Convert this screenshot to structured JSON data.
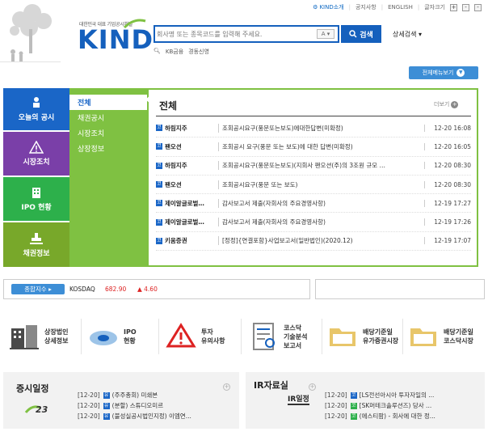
{
  "header": {
    "top_links": [
      "KIND소개",
      "공지사항",
      "ENGLISH",
      "글자크기"
    ],
    "zoom_buttons": [
      "+",
      "-",
      "-"
    ],
    "logo_sub": "대한민국 대표 기업공시채널",
    "logo_text": "KIND",
    "search_placeholder": "회사명 또는 종목코드를 입력해 주세요.",
    "search_select": "A",
    "search_button": "검색",
    "advanced_search": "상세검색",
    "quick_links": [
      "KB금융",
      "경동신영"
    ],
    "full_menu": "전체메뉴보기"
  },
  "nav": [
    {
      "label": "오늘의 공시",
      "icon": "person-icon"
    },
    {
      "label": "시장조치",
      "icon": "warning-icon"
    },
    {
      "label": "IPO 현황",
      "icon": "building-icon"
    },
    {
      "label": "채권정보",
      "icon": "stamp-icon"
    }
  ],
  "submenu": [
    "전체",
    "채권공시",
    "시장조치",
    "상장정보"
  ],
  "panel": {
    "title": "전체",
    "more": "더보기",
    "rows": [
      {
        "badge": "코",
        "company": "하림지주",
        "title": "조회공시요구(풍문또는보도)에대한답변(미확정)",
        "date": "12-20 16:08"
      },
      {
        "badge": "코",
        "company": "팬오션",
        "title": "조회공시 요구(풍문 또는 보도)에 대한 답변(미확정)",
        "date": "12-20 16:05"
      },
      {
        "badge": "코",
        "company": "하림지주",
        "title": "조회공시요구(풍문또는보도)(지회사 팬오션(주)의 3조원 규모 …",
        "date": "12-20 08:30"
      },
      {
        "badge": "코",
        "company": "팬오션",
        "title": "조회공시요구(풍문 또는 보도)",
        "date": "12-20 08:30"
      },
      {
        "badge": "코",
        "company": "제이알글로벌…",
        "title": "감사보고서 제출(자회사의 주요경영사항)",
        "date": "12-19 17:27"
      },
      {
        "badge": "코",
        "company": "제이알글로벌…",
        "title": "감사보고서 제출(자회사의 주요경영사항)",
        "date": "12-19 17:26"
      },
      {
        "badge": "코",
        "company": "키움증권",
        "title": "[정정]{연결포함}사업보고서(일반법인)(2020.12)",
        "date": "12-19 17:07"
      }
    ]
  },
  "index": {
    "label": "종합지수",
    "name": "KOSDAQ",
    "value": "682.90",
    "change": "▲ 4.60"
  },
  "quick_menu": [
    {
      "label": "상장법인\n상세정보",
      "icon": "building-list-icon"
    },
    {
      "label": "IPO\n현황",
      "icon": "chart-disc-icon"
    },
    {
      "label": "투자\n유의사항",
      "icon": "warning-sign-icon"
    },
    {
      "label": "코스닥\n기술분석\n보고서",
      "icon": "report-icon"
    },
    {
      "label": "배당기준일\n유가증권시장",
      "icon": "folder-icon"
    },
    {
      "label": "배당기준일\n코스닥시장",
      "icon": "folder-icon"
    }
  ],
  "schedule": {
    "title": "증시일정",
    "day": "23",
    "items": [
      {
        "date": "[12-20]",
        "badge": "유",
        "text": "(주주총회) 미쇄본"
      },
      {
        "date": "[12-20]",
        "badge": "유",
        "text": "(분할) 스튜디오미르"
      },
      {
        "date": "[12-20]",
        "badge": "유",
        "text": "(불성실공시법인지정) 이엠연..."
      }
    ]
  },
  "ir": {
    "title": "IR자료실",
    "subtitle": "IR일정",
    "items": [
      {
        "date": "[12-20]",
        "badge": "코",
        "text": "[LS전선아시아 투자자일의 ..."
      },
      {
        "date": "[12-20]",
        "badge": "코",
        "text": "[SK머테크솔루션즈) 당사 ..."
      },
      {
        "date": "[12-20]",
        "badge": "코",
        "text": "(에스티팜) - 회사에 대한 정..."
      }
    ]
  },
  "colors": {
    "brand": "#1560bd",
    "green": "#7fc142",
    "red": "#dd2222"
  }
}
